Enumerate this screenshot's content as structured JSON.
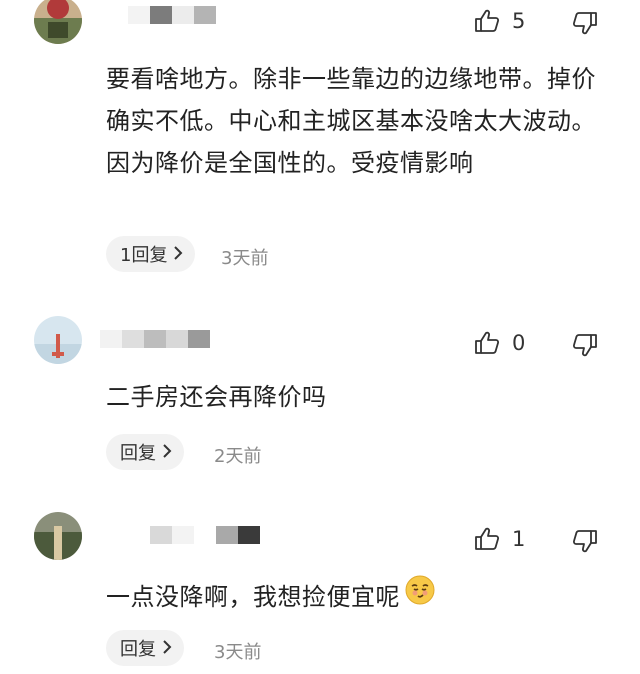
{
  "comments": [
    {
      "like_count": "5",
      "text": "要看啥地方。除非一些靠边的边缘地带。掉价确实不低。中心和主城区基本没啥太大波动。因为降价是全国性的。受疫情影响",
      "reply_label": "1回复",
      "time": "3天前"
    },
    {
      "like_count": "0",
      "text": "二手房还会再降价吗",
      "reply_label": "回复",
      "time": "2天前"
    },
    {
      "like_count": "1",
      "text": "一点没降啊，我想捡便宜呢",
      "reply_label": "回复",
      "time": "3天前"
    }
  ],
  "icons": {
    "like": "thumbs-up-icon",
    "dislike": "thumbs-down-icon",
    "chevron": "chevron-right-icon",
    "emoji": "smirk-emoji"
  },
  "colors": {
    "reply_bg": "#f2f2f2",
    "time": "#8a8a8a"
  }
}
